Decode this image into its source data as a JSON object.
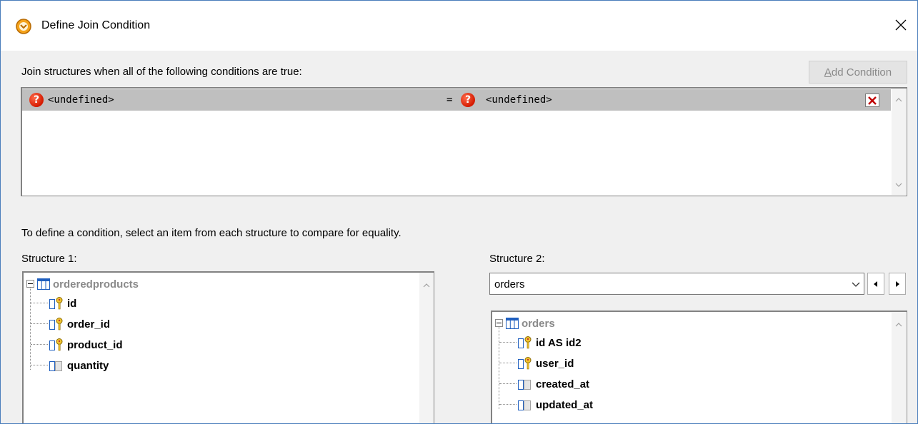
{
  "window": {
    "title": "Define Join Condition",
    "close_label": "✕"
  },
  "conditions": {
    "label": "Join structures when all of the following conditions are true:",
    "add_button_prefix": "A",
    "add_button_rest": "dd Condition",
    "rows": [
      {
        "left": "<undefined>",
        "operator": "=",
        "right": "<undefined>"
      }
    ]
  },
  "hint": "To define a condition, select an item from each structure to compare for equality.",
  "structure1": {
    "label": "Structure 1:",
    "table": "orderedproducts",
    "fields": [
      {
        "name": "id",
        "key": true
      },
      {
        "name": "order_id",
        "key": true
      },
      {
        "name": "product_id",
        "key": true
      },
      {
        "name": "quantity",
        "key": false
      }
    ]
  },
  "structure2": {
    "label": "Structure 2:",
    "selected": "orders",
    "table": "orders",
    "fields": [
      {
        "name": "id AS id2",
        "key": true
      },
      {
        "name": "user_id",
        "key": true
      },
      {
        "name": "created_at",
        "key": false
      },
      {
        "name": "updated_at",
        "key": false
      }
    ]
  },
  "colors": {
    "row_highlight": "#bfbfbf",
    "question_icon": "#d41a00",
    "table_icon": "#1f5fbf",
    "key_icon": "#d4a300",
    "delete_x": "#c00000"
  }
}
